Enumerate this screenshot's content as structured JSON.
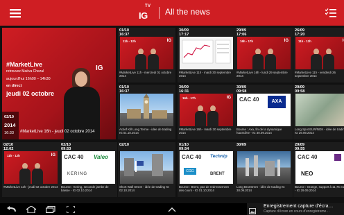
{
  "header": {
    "logo_tv": "TV",
    "logo_ig": "IG",
    "title": "All the news",
    "menu_icon": "hamburger-menu-icon",
    "filter_icon": "checklist-filter-icon"
  },
  "featured": {
    "brand": "#MarketLive",
    "subtitle": "retrouvez Maëva Chezal",
    "time": "aujourd'hui 16h00 – 14h30",
    "live": "en direct",
    "day": "jeudi 02 octobre",
    "ig": "IG",
    "date": "02/10",
    "year": "2014",
    "time_stamp": "16:33",
    "caption": "#MarketLive 16h - jeudi 02 octobre 2014"
  },
  "tiles": [
    {
      "date1": "01/10",
      "date2": "16:37",
      "thumb_text": "11h - 12h",
      "caption": "#MarketLive 11h - mercredi 01 octobre 2014"
    },
    {
      "date1": "30/09",
      "date2": "17:17",
      "thumb_text": "",
      "caption": "#MarketLive 11h - mardi 30 septembre 2014"
    },
    {
      "date1": "29/09",
      "date2": "17:06",
      "thumb_text": "16h - 17h",
      "caption": "#MarketLive 16h - lundi 29 septembre 2014"
    },
    {
      "date1": "26/09",
      "date2": "17:20",
      "thumb_text": "11h - 12h",
      "caption": "#MarketLive 11h - vendredi 26 septembre 2014"
    },
    {
      "date1": "01/10",
      "date2": "16:37",
      "thumb_text": "",
      "caption": "Actief Kill Long Terme - idée de trading IG 01.10.2014"
    },
    {
      "date1": "30/09",
      "date2": "16:31",
      "thumb_text": "16h - 17h",
      "caption": "#MarketLive 16h - mardi 30 septembre 2014"
    },
    {
      "date1": "30/09",
      "date2": "09:58",
      "thumb_text": "CAC 40",
      "caption": "Bourse : Axa, fin de la dynamique haussière - IG 30.09.2014"
    },
    {
      "date1": "29/09",
      "date2": "09:58",
      "thumb_text": "",
      "caption": "Long Spot EUR/NOK - idée de trading IG 29.09.2014"
    },
    {
      "date1": "02/10",
      "date2": "12:02",
      "thumb_text": "11h - 12h",
      "caption": "#MarketLive 11h - jeudi 02 octobre 2014"
    },
    {
      "date1": "02/10",
      "date2": "09:53",
      "thumb_text": "CAC 40",
      "caption": "Bourse : Kering, seconde jambe de baisse - IG 02.10.2014"
    },
    {
      "date1": "02/10",
      "date2": "",
      "thumb_text": "",
      "caption": "Short Wall Street - idée de trading IG 02.10.2014"
    },
    {
      "date1": "01/10",
      "date2": "09:54",
      "thumb_text": "CAC 40",
      "caption": "Bourse : Brent, pas de redressement des cours - IG 01.10.2014"
    },
    {
      "date1": "30/09",
      "date2": "",
      "thumb_text": "",
      "caption": "Long Brut Brent - idée de trading IG 30.09.2014"
    },
    {
      "date1": "29/09",
      "date2": "09:55",
      "thumb_text": "CAC 40",
      "caption": "Bourse : Orange, support à 11,75 euros - IG 29.09.2014"
    }
  ],
  "logos": {
    "axa": "AXA",
    "valeo": "Valeo",
    "kering": "KERING",
    "technip": "Technip",
    "brent": "BRENT",
    "cgg": "CGG",
    "neopost": "NEO"
  },
  "navbar": {
    "back_icon": "back-icon",
    "home_icon": "home-icon",
    "recent_icon": "recent-apps-icon",
    "screenshot_icon": "screenshot-icon",
    "up_icon": "chevron-up-icon"
  },
  "notification": {
    "title": "Enregistrement capture d'écra…",
    "subtitle": "Capture d'écran en cours d'enregistreme…"
  }
}
